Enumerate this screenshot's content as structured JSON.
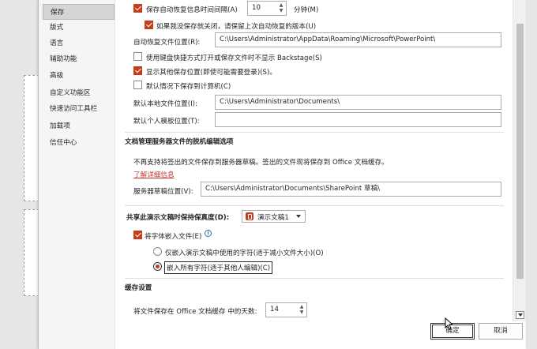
{
  "nav": {
    "items": [
      "保存",
      "版式",
      "语言",
      "辅助功能",
      "高级",
      "自定义功能区",
      "快速访问工具栏",
      "加载项",
      "信任中心"
    ],
    "selected": "保存"
  },
  "save": {
    "autorecover_label": "保存自动恢复信息时间间隔(A)",
    "autorecover_minutes": "10",
    "minutes_label": "分钟(M)",
    "keep_last_label": "如果我没保存就关闭，请保留上次自动恢复的版本(U)",
    "autorecover_path_label": "自动恢复文件位置(R):",
    "autorecover_path": "C:\\Users\\Administrator\\AppData\\Roaming\\Microsoft\\PowerPoint\\",
    "no_backstage_label": "使用键盘快捷方式打开或保存文件时不显示 Backstage(S)",
    "show_other_label": "显示其他保存位置(即使可能需要登录)(S)。",
    "default_computer_label": "默认情况下保存到计算机(C)",
    "default_local_label": "默认本地文件位置(I):",
    "default_local_path": "C:\\Users\\Administrator\\Documents\\",
    "default_template_label": "默认个人模板位置(T):",
    "default_template_path": ""
  },
  "offline": {
    "title": "文档管理服务器文件的脱机编辑选项",
    "desc": "不再支持将签出的文件保存到服务器草稿。签出的文件现将保存到 Office 文档缓存。",
    "learn_more": "了解详细信息",
    "drafts_label": "服务器草稿位置(V):",
    "drafts_path": "C:\\Users\\Administrator\\Documents\\SharePoint 草稿\\"
  },
  "fidelity": {
    "title": "共享此演示文稿时保持保真度(D):",
    "presentation": "演示文稿1",
    "embed_fonts_label": "将字体嵌入文件(E)",
    "info_icon": "i",
    "embed_used_label": "仅嵌入演示文稿中使用的字符(适于减小文件大小)(O)",
    "embed_all_label": "嵌入所有字符(适于其他人编辑)(C)"
  },
  "cache": {
    "title": "缓存设置",
    "days_label": "将文件保存在 Office 文档缓存 中的天数:",
    "days_value": "14"
  },
  "buttons": {
    "ok": "确定",
    "cancel": "取消"
  },
  "colors": {
    "accent": "#c43e1c",
    "link": "#c0392b"
  }
}
